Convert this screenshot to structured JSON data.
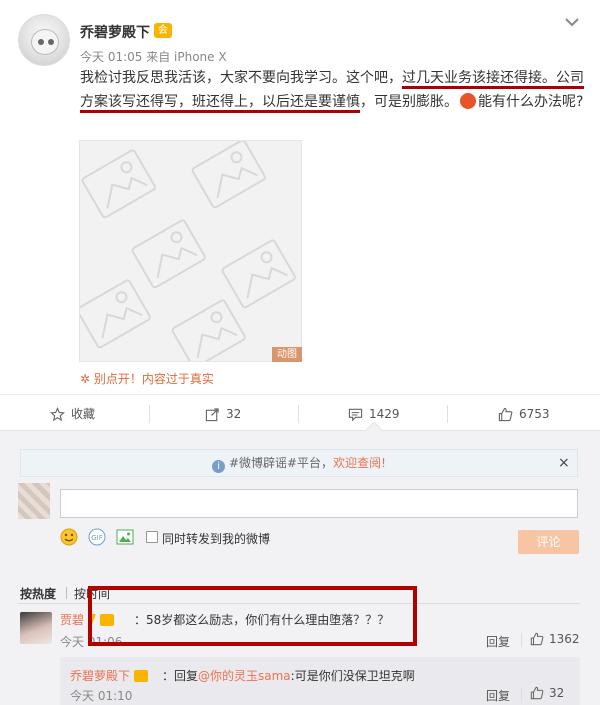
{
  "post": {
    "username": "乔碧萝殿下",
    "vip_badge": "会",
    "meta": "今天 01:05 来自 iPhone X",
    "content": {
      "part1": "我检讨我反思我活该，大家不要向我学习。这个吧，",
      "highlight1": "过几天业务该接还得接。公司方案该写还得写，班还得上，以后还是要谨慎",
      "part2": "，可是别膨胀。",
      "part3": "能有什么办法呢?"
    },
    "gif_tag": "动图",
    "warning": "别点开！内容过于真实",
    "colors": {
      "accent": "#eb7350",
      "highlight_underline": "#a00000"
    }
  },
  "actions": {
    "favorite": {
      "icon": "star-icon",
      "label": "收藏"
    },
    "forward": {
      "icon": "share-icon",
      "count": "32"
    },
    "comment": {
      "icon": "comment-icon",
      "count": "1429"
    },
    "like": {
      "icon": "thumbs-up-icon",
      "count": "6753"
    }
  },
  "comment_panel": {
    "notice": {
      "prefix": "#微博辟谣#平台，",
      "link": "欢迎查阅!",
      "close": "×"
    },
    "input_placeholder": "",
    "forward_label": "同时转发到我的微博",
    "submit_label": "评论",
    "sort_hot": "按热度",
    "sort_time": "按时间"
  },
  "comments": [
    {
      "name": "贾碧",
      "text": "：58岁都这么励志，你们有什么理由堕落？？？",
      "time": "今天 01:06",
      "reply_label": "回复",
      "likes": "1362",
      "replies": [
        {
          "name": "乔碧萝殿下",
          "reply_prefix": "：回复",
          "mention": "@你的灵玉sama",
          "text": ":可是你们没保卫坦克啊",
          "time": "今天 01:10",
          "reply_label": "回复",
          "likes": "32"
        }
      ]
    }
  ]
}
